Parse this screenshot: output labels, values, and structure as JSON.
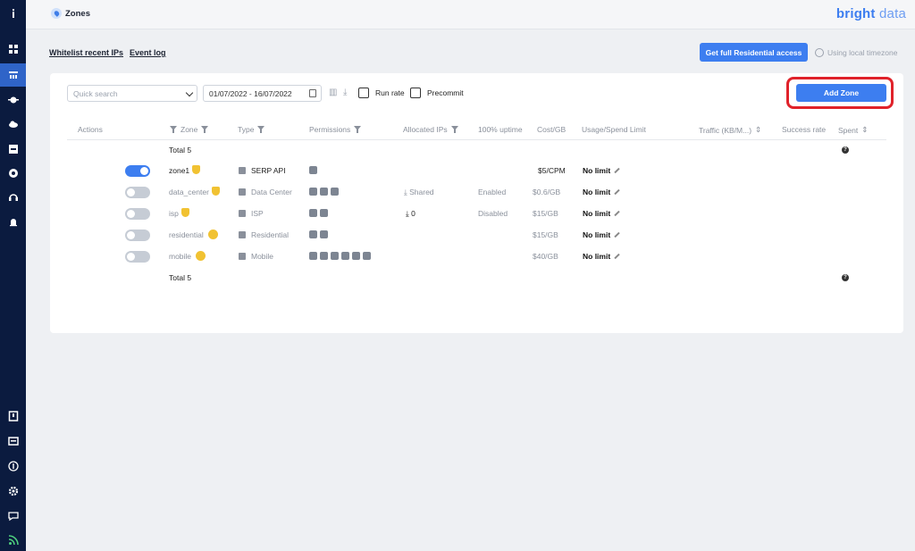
{
  "topbar": {
    "title": "Zones",
    "brand_main": "bright",
    "brand_light": "data"
  },
  "links": {
    "whitelist": "Whitelist recent IPs",
    "event_log": "Event log"
  },
  "actions": {
    "full_access": "Get full Residential access",
    "timezone": "Using local timezone"
  },
  "toolbar": {
    "search_placeholder": "Quick search",
    "date_range": "01/07/2022 - 16/07/2022",
    "run_rate": "Run rate",
    "precommit": "Precommit",
    "add_zone": "Add Zone"
  },
  "table": {
    "headers": {
      "actions": "Actions",
      "zone": "Zone",
      "type": "Type",
      "permissions": "Permissions",
      "allocated": "Allocated IPs",
      "uptime": "100% uptime",
      "cost": "Cost/GB",
      "usage": "Usage/Spend Limit",
      "traffic": "Traffic (KB/M...)",
      "success": "Success rate",
      "spent": "Spent"
    },
    "total_top": "Total 5",
    "total_bottom": "Total 5",
    "rows": [
      {
        "zone": "zone1",
        "type": "SERP API",
        "allocated": "",
        "uptime": "",
        "cost": "$5/CPM",
        "limit": "No limit"
      },
      {
        "zone": "data_center",
        "type": "Data Center",
        "allocated": "Shared",
        "uptime": "Enabled",
        "cost": "$0.6/GB",
        "limit": "No limit"
      },
      {
        "zone": "isp",
        "type": "ISP",
        "allocated": "0",
        "uptime": "Disabled",
        "cost": "$15/GB",
        "limit": "No limit"
      },
      {
        "zone": "residential",
        "type": "Residential",
        "allocated": "",
        "uptime": "",
        "cost": "$15/GB",
        "limit": "No limit"
      },
      {
        "zone": "mobile",
        "type": "Mobile",
        "allocated": "",
        "uptime": "",
        "cost": "$40/GB",
        "limit": "No limit"
      }
    ]
  },
  "colors": {
    "sidebar": "#0b1b3f",
    "accent": "#3d7ef0",
    "highlight": "#e0222a"
  }
}
